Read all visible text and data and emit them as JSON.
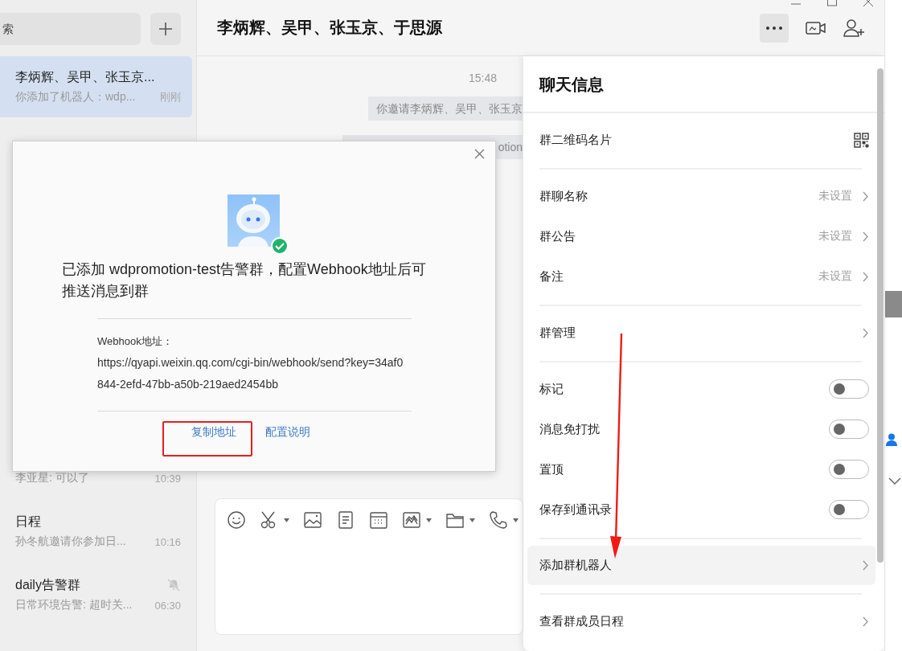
{
  "sidebar": {
    "search": {
      "placeholder": "索"
    },
    "conversations": [
      {
        "title": "李炳辉、吴甲、张玉京...",
        "preview": "你添加了机器人：wdp...",
        "time": "刚刚",
        "selected": true,
        "muted": false
      },
      {
        "preview": "李亚星: 可以了",
        "time": "10:39",
        "selected": false,
        "muted": false
      },
      {
        "title": "日程",
        "preview": "孙冬航邀请你参加日...",
        "time": "10:16",
        "selected": false,
        "muted": false
      },
      {
        "title": "daily告警群",
        "preview": "日常环境告警: 超时关...",
        "time": "06:30",
        "selected": false,
        "muted": true
      }
    ]
  },
  "chat": {
    "title": "李炳辉、吴甲、张玉京、于思源",
    "messages": [
      {
        "kind": "time",
        "text": "15:48"
      },
      {
        "kind": "system",
        "text": "你邀请李炳辉、吴甲、张玉京"
      },
      {
        "kind": "system",
        "text": "otion"
      }
    ]
  },
  "dialog": {
    "message": "已添加 wdpromotion-test告警群，配置Webhook地址后可推送消息到群",
    "webhook_label": "Webhook地址：",
    "webhook_url": "https://qyapi.weixin.qq.com/cgi-bin/webhook/send?key=34af0844-2efd-47bb-a50b-219aed2454bb",
    "actions": [
      {
        "label": "复制地址"
      },
      {
        "label": "配置说明"
      }
    ]
  },
  "info_panel": {
    "title": "聊天信息",
    "sections": [
      {
        "rows": [
          {
            "kind": "qr",
            "label": "群二维码名片",
            "highlighted": false
          }
        ]
      },
      {
        "rows": [
          {
            "kind": "link",
            "label": "群聊名称",
            "value": "未设置",
            "highlighted": false
          },
          {
            "kind": "link",
            "label": "群公告",
            "value": "未设置",
            "highlighted": false
          },
          {
            "kind": "link",
            "label": "备注",
            "value": "未设置",
            "highlighted": false
          }
        ]
      },
      {
        "rows": [
          {
            "kind": "link",
            "label": "群管理",
            "highlighted": false
          }
        ]
      },
      {
        "rows": [
          {
            "kind": "toggle",
            "label": "标记",
            "on": false,
            "highlighted": false
          },
          {
            "kind": "toggle",
            "label": "消息免打扰",
            "on": false,
            "highlighted": false
          },
          {
            "kind": "toggle",
            "label": "置顶",
            "on": false,
            "highlighted": false
          },
          {
            "kind": "toggle",
            "label": "保存到通讯录",
            "on": false,
            "highlighted": false
          }
        ]
      },
      {
        "rows": [
          {
            "kind": "link",
            "label": "添加群机器人",
            "highlighted": true
          }
        ]
      },
      {
        "rows": [
          {
            "kind": "link",
            "label": "查看群成员日程",
            "highlighted": false
          }
        ]
      }
    ]
  },
  "annotations": {
    "highlight_box": true,
    "arrow": true
  }
}
